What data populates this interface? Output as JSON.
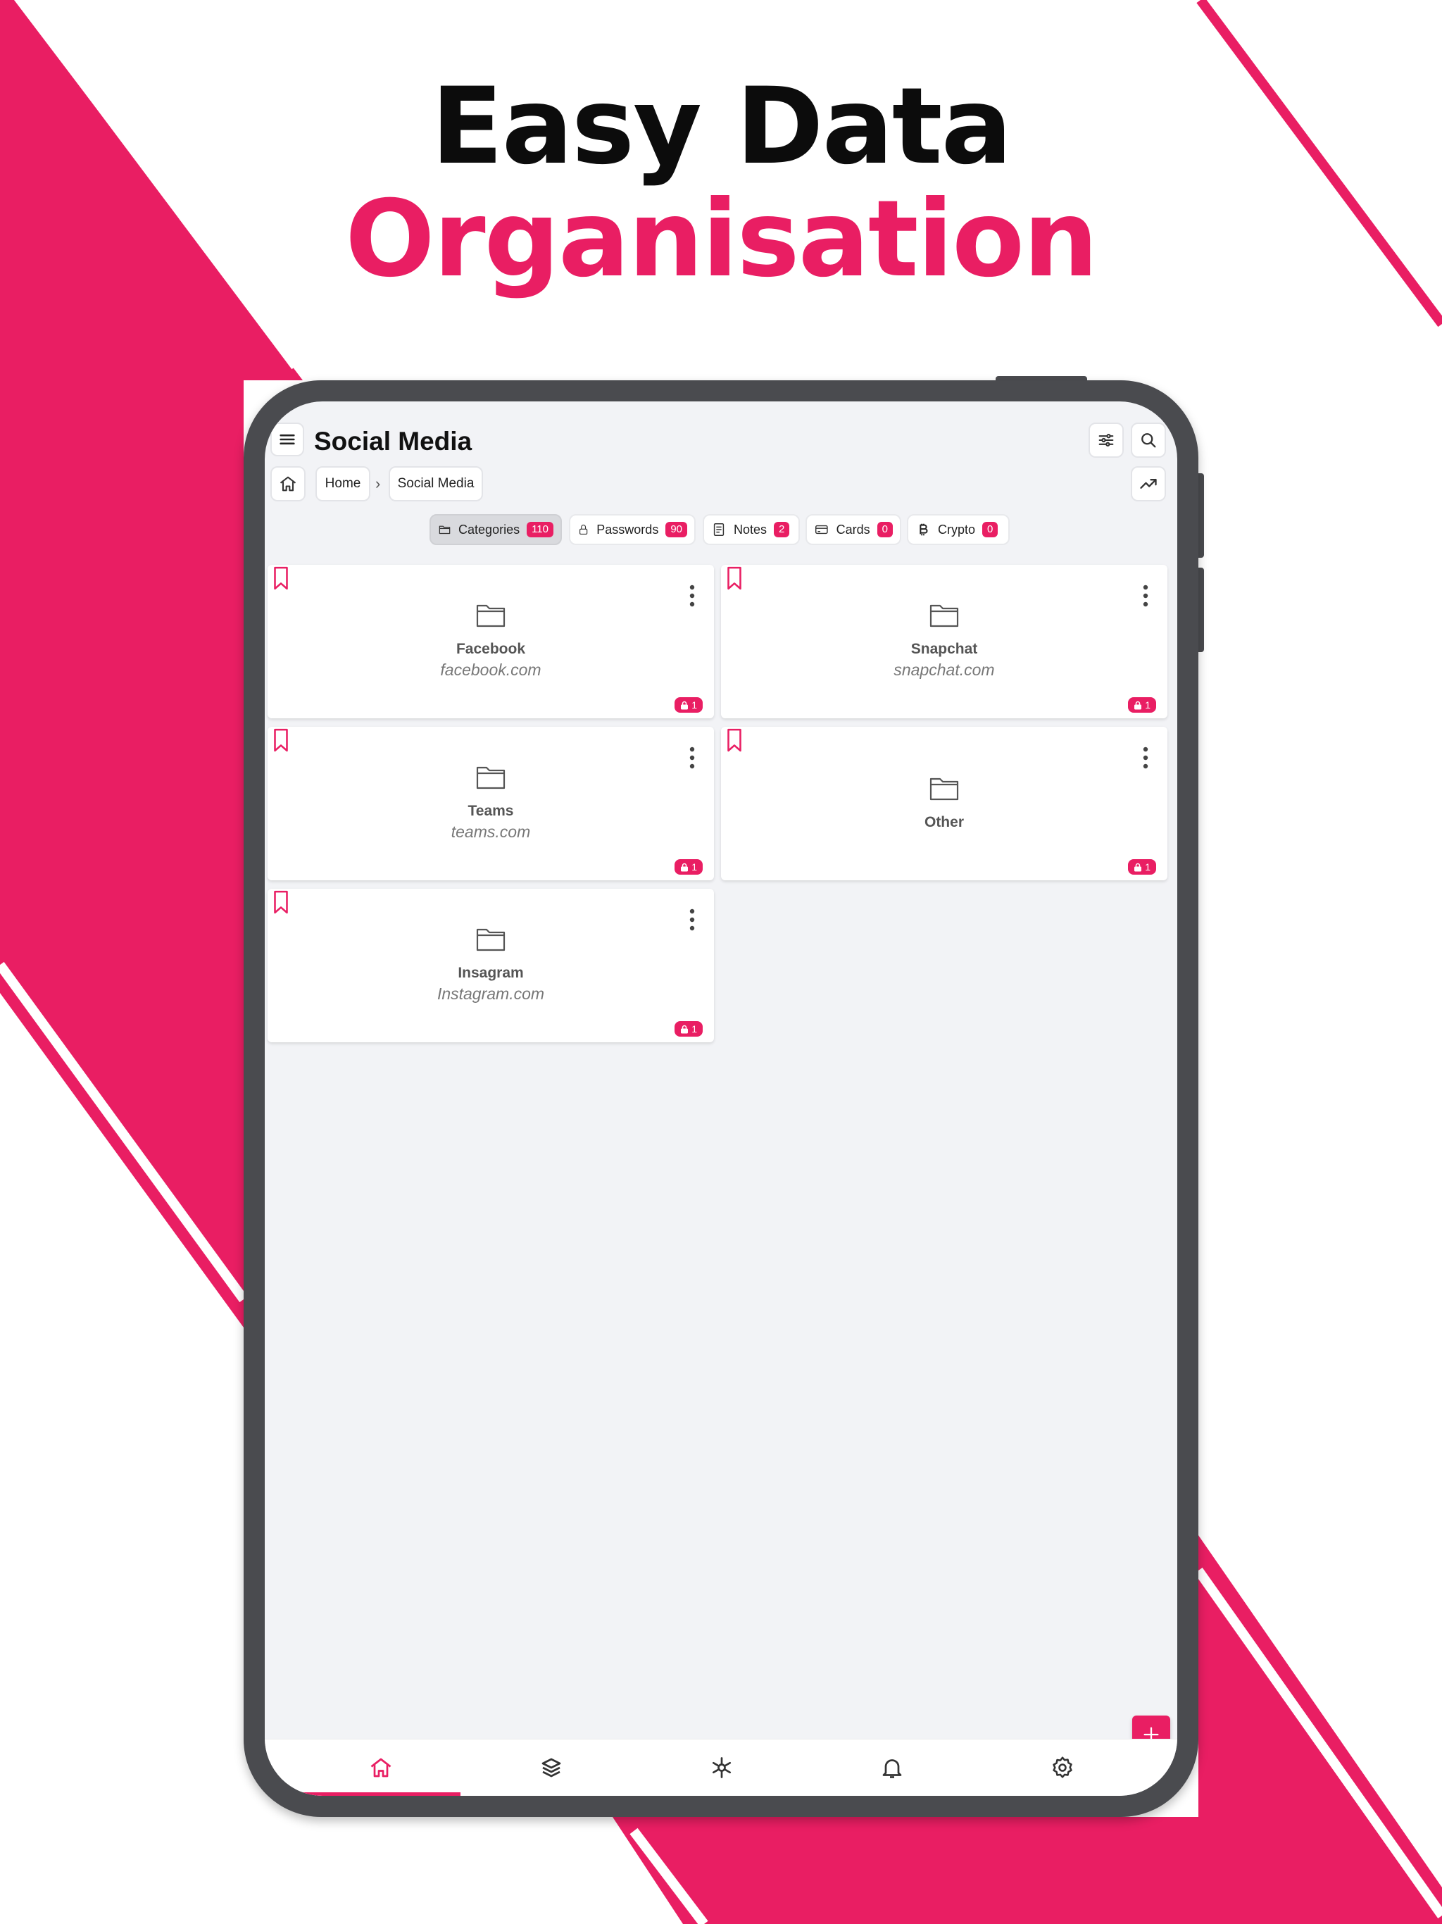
{
  "promo": {
    "line1": "Easy Data",
    "line2": "Organisation"
  },
  "colors": {
    "accent": "#e91e63",
    "frame": "#4a4b4f",
    "screen_bg": "#f2f3f6"
  },
  "header": {
    "title": "Social Media",
    "menu_icon": "menu-icon",
    "filter_icon": "sliders-icon",
    "search_icon": "search-icon",
    "trend_icon": "trending-up-icon"
  },
  "breadcrumb": {
    "home_icon": "home-icon",
    "items": [
      "Home",
      "Social Media"
    ],
    "separator": "›"
  },
  "tabs": [
    {
      "label": "Categories",
      "count": "110",
      "icon": "folder-icon",
      "active": true
    },
    {
      "label": "Passwords",
      "count": "90",
      "icon": "lock-icon",
      "active": false
    },
    {
      "label": "Notes",
      "count": "2",
      "icon": "note-icon",
      "active": false
    },
    {
      "label": "Cards",
      "count": "0",
      "icon": "credit-card-icon",
      "active": false
    },
    {
      "label": "Crypto",
      "count": "0",
      "icon": "bitcoin-icon",
      "active": false
    }
  ],
  "categories": [
    {
      "name": "Facebook",
      "domain": "facebook.com",
      "count": "1"
    },
    {
      "name": "Snapchat",
      "domain": "snapchat.com",
      "count": "1"
    },
    {
      "name": "Teams",
      "domain": "teams.com",
      "count": "1"
    },
    {
      "name": "Other",
      "domain": "",
      "count": "1"
    },
    {
      "name": "Insagram",
      "domain": "Instagram.com",
      "count": "1"
    }
  ],
  "fab": {
    "icon": "plus-icon"
  },
  "bottom_nav": [
    {
      "icon": "home-icon",
      "active": true
    },
    {
      "icon": "layers-icon",
      "active": false
    },
    {
      "icon": "asterisk-icon",
      "active": false
    },
    {
      "icon": "bell-icon",
      "active": false
    },
    {
      "icon": "settings-icon",
      "active": false
    }
  ]
}
